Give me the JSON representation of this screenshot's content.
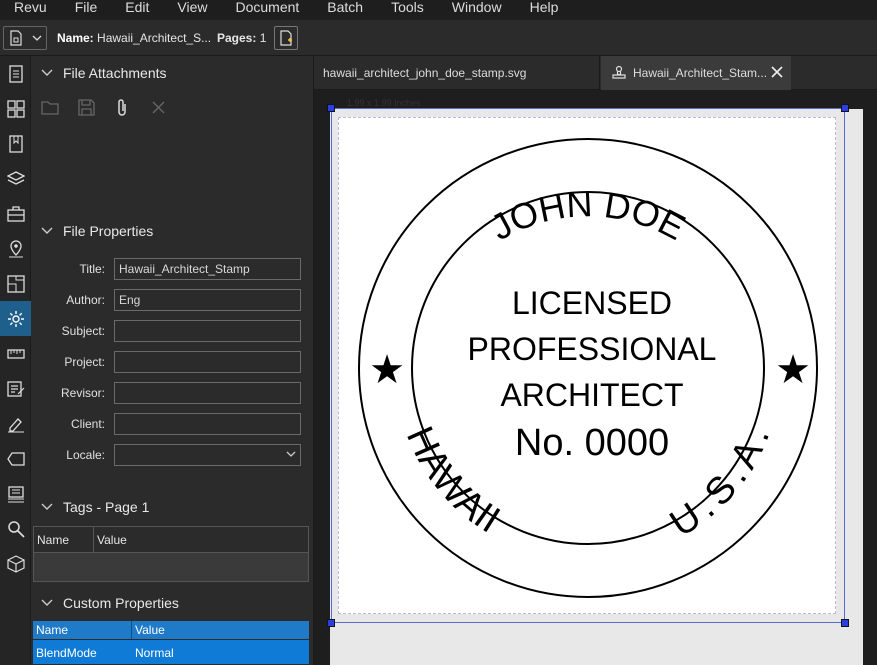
{
  "menu": [
    "Revu",
    "File",
    "Edit",
    "View",
    "Document",
    "Batch",
    "Tools",
    "Window",
    "Help"
  ],
  "toolbar": {
    "name_label": "Name:",
    "name_value": "Hawaii_Architect_S...",
    "pages_label": "Pages:",
    "pages_value": "1"
  },
  "sidebar_icons": [
    "thumbnails-icon",
    "panels-icon",
    "bookmarks-icon",
    "layers-icon",
    "toolbox-icon",
    "places-icon",
    "forms-icon",
    "properties-icon",
    "measurements-icon",
    "markups-list-icon",
    "signatures-icon",
    "tags-icon",
    "stamps-icon",
    "search-icon",
    "3d-icon"
  ],
  "active_sidebar_icon": "properties-icon",
  "attachments": {
    "title": "File Attachments"
  },
  "properties": {
    "title": "File Properties",
    "fields": [
      {
        "label": "Title:",
        "value": "Hawaii_Architect_Stamp"
      },
      {
        "label": "Author:",
        "value": "Eng"
      },
      {
        "label": "Subject:",
        "value": ""
      },
      {
        "label": "Project:",
        "value": ""
      },
      {
        "label": "Revisor:",
        "value": ""
      },
      {
        "label": "Client:",
        "value": ""
      }
    ],
    "locale_label": "Locale:",
    "locale_value": ""
  },
  "tags": {
    "title": "Tags - Page 1",
    "col_name": "Name",
    "col_value": "Value"
  },
  "custom": {
    "title": "Custom Properties",
    "col_name": "Name",
    "col_value": "Value",
    "rows": [
      {
        "name": "BlendMode",
        "value": "Normal"
      }
    ]
  },
  "tabs": [
    {
      "label": "hawaii_architect_john_doe_stamp.svg",
      "active": false
    },
    {
      "label": "Hawaii_Architect_Stam...",
      "active": true
    }
  ],
  "document": {
    "size_label": "1.99 x 1.99 Inches",
    "stamp": {
      "top_arc": "JOHN DOE",
      "line1": "LICENSED",
      "line2": "PROFESSIONAL",
      "line3": "ARCHITECT",
      "line4": "No. 0000",
      "bottom_left": "HAWAII",
      "bottom_right": "U.S.A.",
      "star": "★"
    }
  },
  "colors": {
    "accent": "#1f7ac8",
    "selected_row": "#0f7bd6",
    "active_icon_bg": "#1f5f8b",
    "handle": "#2a3fe0"
  }
}
